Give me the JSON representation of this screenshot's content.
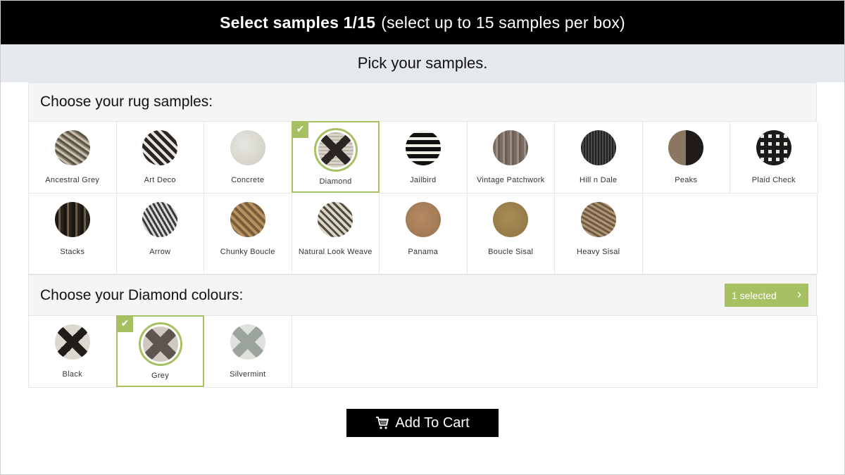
{
  "header": {
    "title_bold": "Select samples 1/15",
    "title_rest": "(select up to 15 samples per box)",
    "subtitle": "Pick your samples."
  },
  "rugs": {
    "heading": "Choose your rug samples:",
    "items": [
      {
        "label": "Ancestral Grey",
        "icon": "ancestral-grey-swatch",
        "selected": false
      },
      {
        "label": "Art Deco",
        "icon": "art-deco-swatch",
        "selected": false
      },
      {
        "label": "Concrete",
        "icon": "concrete-swatch",
        "selected": false
      },
      {
        "label": "Diamond",
        "icon": "diamond-swatch",
        "selected": true
      },
      {
        "label": "Jailbird",
        "icon": "jailbird-swatch",
        "selected": false
      },
      {
        "label": "Vintage Patchwork",
        "icon": "vintage-patchwork-swatch",
        "selected": false
      },
      {
        "label": "Hill n Dale",
        "icon": "hill-n-dale-swatch",
        "selected": false
      },
      {
        "label": "Peaks",
        "icon": "peaks-swatch",
        "selected": false
      },
      {
        "label": "Plaid Check",
        "icon": "plaid-check-swatch",
        "selected": false
      },
      {
        "label": "Stacks",
        "icon": "stacks-swatch",
        "selected": false
      },
      {
        "label": "Arrow",
        "icon": "arrow-swatch",
        "selected": false
      },
      {
        "label": "Chunky Boucle",
        "icon": "chunky-boucle-swatch",
        "selected": false
      },
      {
        "label": "Natural Look Weave",
        "icon": "natural-look-weave-swatch",
        "selected": false
      },
      {
        "label": "Panama",
        "icon": "panama-swatch",
        "selected": false
      },
      {
        "label": "Boucle Sisal",
        "icon": "boucle-sisal-swatch",
        "selected": false
      },
      {
        "label": "Heavy Sisal",
        "icon": "heavy-sisal-swatch",
        "selected": false
      }
    ]
  },
  "colours": {
    "heading": "Choose your Diamond colours:",
    "selected_label": "1 selected",
    "items": [
      {
        "label": "Black",
        "icon": "black-swatch",
        "selected": false
      },
      {
        "label": "Grey",
        "icon": "grey-swatch",
        "selected": true
      },
      {
        "label": "Silvermint",
        "icon": "silvermint-swatch",
        "selected": false
      }
    ]
  },
  "cart": {
    "label": "Add To Cart",
    "icon": "cart-icon"
  },
  "colors": {
    "accent_green": "#a6c062",
    "header_bg": "#000000",
    "subheader_bg": "#e5e8ec"
  },
  "check_glyph": "✔",
  "chevron_glyph": "›"
}
